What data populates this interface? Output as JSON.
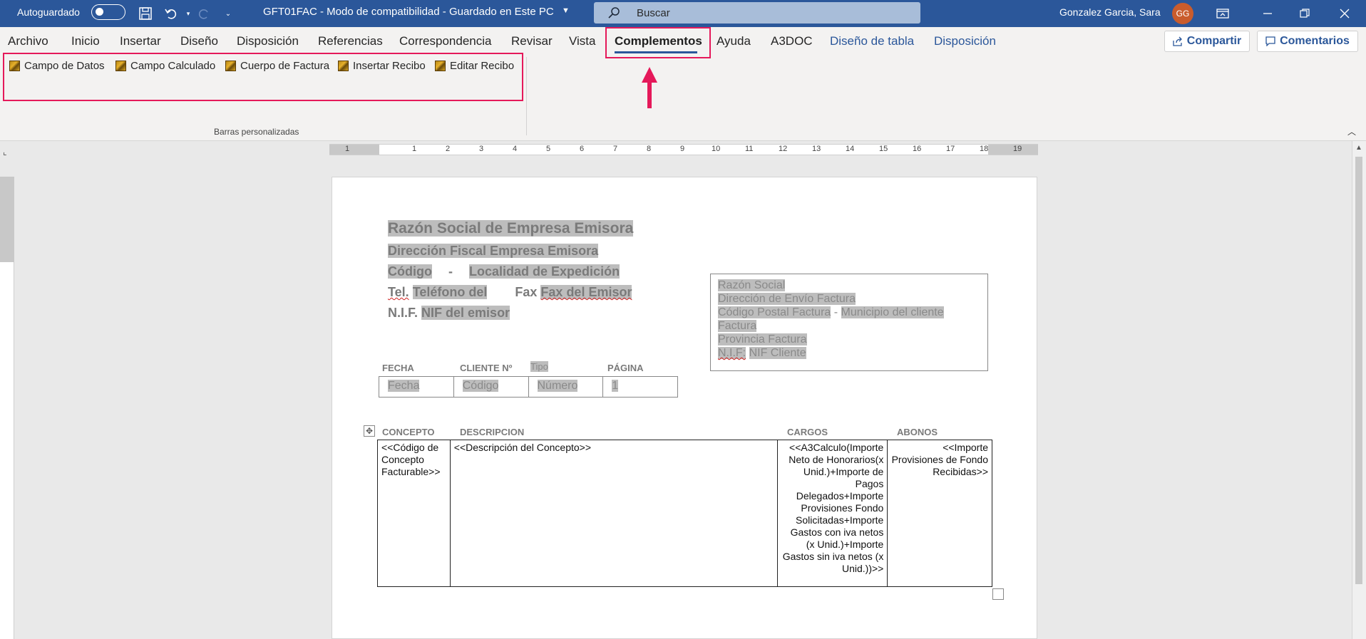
{
  "titlebar": {
    "autosave_label": "Autoguardado",
    "doc_title": "GFT01FAC  -  Modo de compatibilidad  -  Guardado en Este PC",
    "search_placeholder": "Buscar",
    "user_name": "Gonzalez Garcia, Sara",
    "user_initials": "GG"
  },
  "tabs": [
    "Archivo",
    "Inicio",
    "Insertar",
    "Diseño",
    "Disposición",
    "Referencias",
    "Correspondencia",
    "Revisar",
    "Vista",
    "Complementos",
    "Ayuda",
    "A3DOC",
    "Diseño de tabla",
    "Disposición"
  ],
  "actions": {
    "share": "Compartir",
    "comments": "Comentarios"
  },
  "ribbon_commands": [
    "Campo de Datos",
    "Campo Calculado",
    "Cuerpo de Factura",
    "Insertar Recibo",
    "Editar Recibo"
  ],
  "group_label": "Barras personalizadas",
  "ruler_numbers": [
    "1",
    "1",
    "2",
    "3",
    "4",
    "5",
    "6",
    "7",
    "8",
    "9",
    "10",
    "11",
    "12",
    "13",
    "14",
    "15",
    "16",
    "17",
    "18",
    "19"
  ],
  "document": {
    "emisor": {
      "razon_social": "Razón Social de Empresa Emisora",
      "direccion": "Dirección Fiscal Empresa Emisora",
      "codigo": "Código",
      "separator": "-",
      "localidad": "Localidad de Expedición",
      "tel_label": "Tel.",
      "telefono": "Teléfono del",
      "fax_label": "Fax",
      "fax": "Fax del Emisor",
      "nif_label": "N.I.F.",
      "nif": "NIF del emisor"
    },
    "cliente": {
      "razon_social": "Razón Social",
      "direccion": "Dirección de Envío Factura",
      "cp": "Código Postal Factura",
      "cp_sep": " - ",
      "municipio": "Municipio del cliente",
      "factura": "Factura",
      "provincia": "Provincia Factura",
      "nif_label": "N.I.F:",
      "nif": "NIF Cliente"
    },
    "header_table": {
      "headers": [
        "FECHA",
        "CLIENTE Nº",
        "Tipo",
        "PÁGINA"
      ],
      "values": [
        "Fecha",
        "Código",
        "Número",
        "1"
      ]
    },
    "main_table": {
      "headers": [
        "CONCEPTO",
        "DESCRIPCION",
        "CARGOS",
        "ABONOS"
      ],
      "concepto": "<<Código de Concepto Facturable>>",
      "descripcion": "<<Descripción del Concepto>>",
      "cargos": "<<A3Calculo(Importe Neto de Honorarios(x Unid.)+Importe de Pagos Delegados+Importe Provisiones Fondo Solicitadas+Importe Gastos con iva netos (x Unid.)+Importe Gastos sin iva netos (x Unid.))>>",
      "abonos": "<<Importe Provisiones de Fondo Recibidas>>"
    }
  },
  "colors": {
    "titlebar": "#2b579a",
    "highlight": "#e5195a",
    "avatar": "#c95c2c"
  }
}
